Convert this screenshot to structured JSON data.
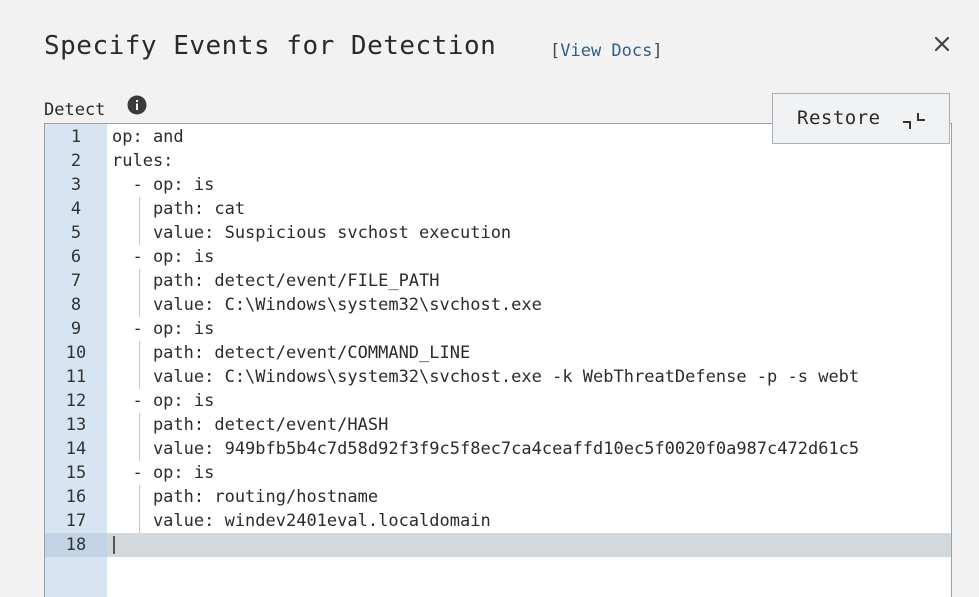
{
  "dialog": {
    "title": "Specify Events for Detection",
    "docs_open_bracket": "[",
    "docs_link": "View Docs",
    "docs_close_bracket": "]",
    "close_icon": "close-icon"
  },
  "detect": {
    "label": "Detect",
    "info_icon": "info-icon"
  },
  "restore_button": {
    "label": "Restore",
    "icon": "collapse-icon"
  },
  "editor": {
    "active_line": 18,
    "lines": [
      {
        "num": "1",
        "text": "op: and"
      },
      {
        "num": "2",
        "text": "rules:"
      },
      {
        "num": "3",
        "text": "  - op: is"
      },
      {
        "num": "4",
        "text": "    path: cat"
      },
      {
        "num": "5",
        "text": "    value: Suspicious svchost execution"
      },
      {
        "num": "6",
        "text": "  - op: is"
      },
      {
        "num": "7",
        "text": "    path: detect/event/FILE_PATH"
      },
      {
        "num": "8",
        "text": "    value: C:\\Windows\\system32\\svchost.exe"
      },
      {
        "num": "9",
        "text": "  - op: is"
      },
      {
        "num": "10",
        "text": "    path: detect/event/COMMAND_LINE"
      },
      {
        "num": "11",
        "text": "    value: C:\\Windows\\system32\\svchost.exe -k WebThreatDefense -p -s webt"
      },
      {
        "num": "12",
        "text": "  - op: is"
      },
      {
        "num": "13",
        "text": "    path: detect/event/HASH"
      },
      {
        "num": "14",
        "text": "    value: 949bfb5b4c7d58d92f3f9c5f8ec7ca4ceaffd10ec5f0020f0a987c472d61c5"
      },
      {
        "num": "15",
        "text": "  - op: is"
      },
      {
        "num": "16",
        "text": "    path: routing/hostname"
      },
      {
        "num": "17",
        "text": "    value: windev2401eval.localdomain"
      },
      {
        "num": "18",
        "text": ""
      }
    ]
  },
  "colors": {
    "gutter": "#d7e5f3",
    "active_line": "#d3d8dd",
    "link": "#2d5f8b"
  }
}
